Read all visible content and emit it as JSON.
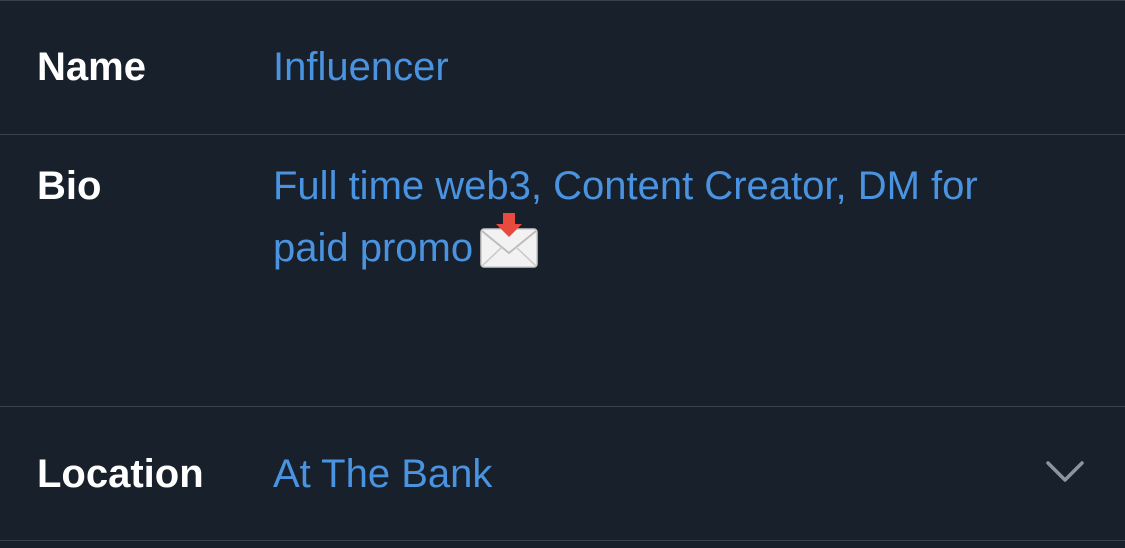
{
  "profile_form": {
    "name": {
      "label": "Name",
      "value": "Influencer"
    },
    "bio": {
      "label": "Bio",
      "line1": "Full time web3, Content Creator, DM for",
      "line2": "paid promo",
      "emoji": "envelope-with-arrow-icon"
    },
    "location": {
      "label": "Location",
      "value": "At The Bank",
      "dropdown_icon": "chevron-down-icon"
    }
  },
  "colors": {
    "background": "#18202b",
    "divider": "#384150",
    "label": "#ffffff",
    "value": "#4a93e0",
    "chevron": "#8b95a1"
  }
}
